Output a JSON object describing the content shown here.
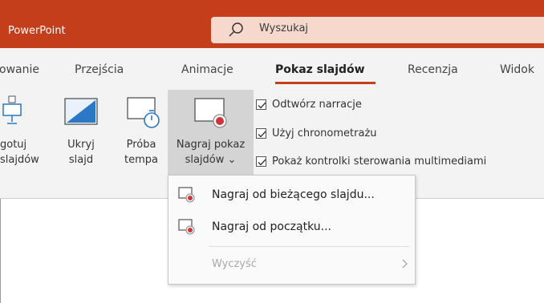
{
  "titlebar": {
    "app_name": "PowerPoint",
    "search_placeholder": "Wyszukaj",
    "accent": "#c43e1c"
  },
  "ribbon": {
    "tabs": [
      {
        "label": "owanie"
      },
      {
        "label": "Przejścia"
      },
      {
        "label": "Animacje"
      },
      {
        "label": "Pokaz slajdów",
        "active": true
      },
      {
        "label": "Recenzja"
      },
      {
        "label": "Widok"
      }
    ],
    "commands": {
      "setup": {
        "line1": "gotuj",
        "line2": "slajdów"
      },
      "hide": {
        "line1": "Ukryj",
        "line2": "slajd"
      },
      "rehearse": {
        "line1": "Próba",
        "line2": "tempa"
      },
      "record": {
        "line1": "Nagraj pokaz",
        "line2": "slajdów",
        "chevron": "⌄"
      }
    },
    "checkboxes": [
      {
        "label": "Odtwórz narracje",
        "checked": true
      },
      {
        "label": "Użyj chronometrażu",
        "checked": true
      },
      {
        "label": "Pokaż kontrolki sterowania multimediami",
        "checked": true
      }
    ]
  },
  "record_menu": {
    "items": [
      {
        "label": "Nagraj od bieżącego slajdu...",
        "icon": "record-slide-icon"
      },
      {
        "label": "Nagraj od początku...",
        "icon": "record-slide-icon"
      }
    ],
    "clear": {
      "label": "Wyczyść",
      "disabled": true,
      "icon": "chevron-right-icon"
    }
  }
}
